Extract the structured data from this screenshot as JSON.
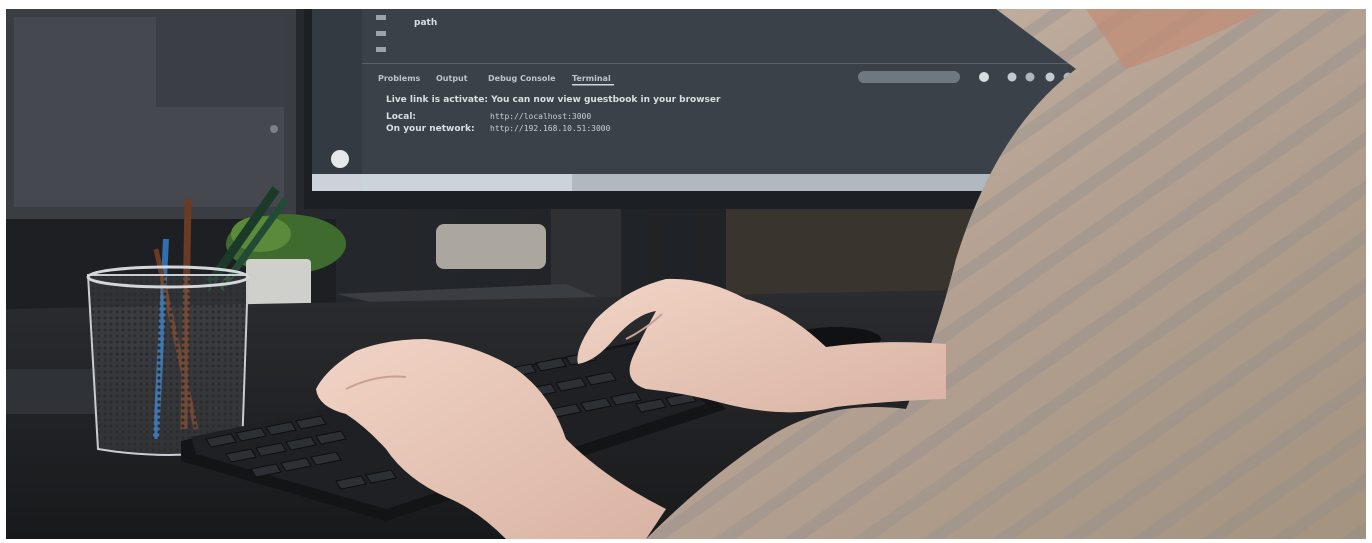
{
  "image": {
    "alt": "Person typing on a black keyboard at a desk in front of a monitor showing a code editor terminal"
  },
  "monitor": {
    "panel_tabs": [
      "Problems",
      "Output",
      "Debug Console",
      "Terminal"
    ],
    "terminal_lines": [
      "Live link is activate: You can now view guestbook in your browser"
    ],
    "address_rows": [
      {
        "label": "Local:",
        "value": "http://localhost:3000"
      },
      {
        "label": "On your network:",
        "value": "http://192.168.10.51:3000"
      }
    ],
    "code_line": "path"
  }
}
